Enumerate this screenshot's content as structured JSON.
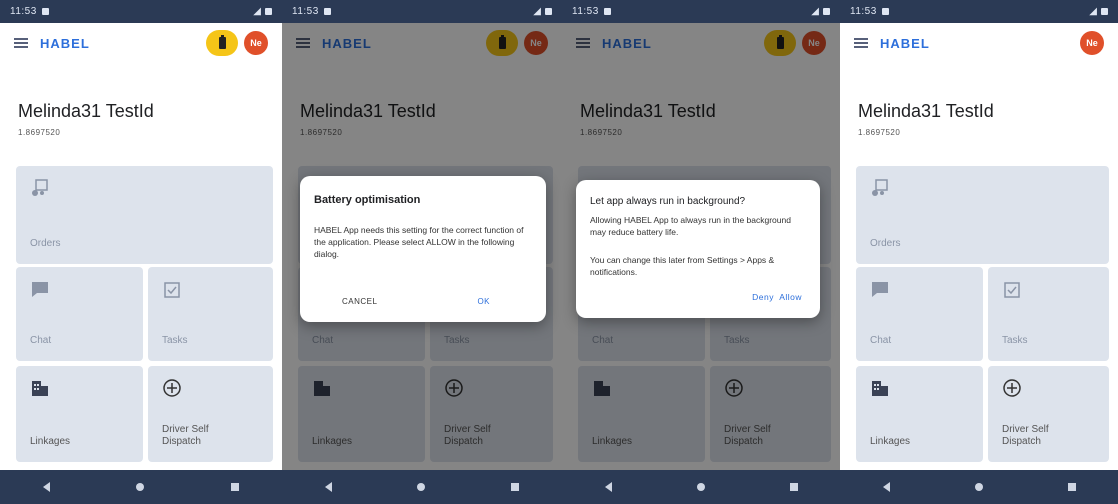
{
  "status_bar": {
    "left_text": "11:53",
    "right_text": ""
  },
  "app": {
    "brand": "HABEL",
    "avatar_initials": "Ne"
  },
  "profile": {
    "name": "Melinda31 TestId",
    "id_text": "1.8697520"
  },
  "tiles": {
    "orders": "Orders",
    "chat": "Chat",
    "tasks": "Tasks",
    "linkages": "Linkages",
    "driver_self_dispatch": "Driver Self Dispatch"
  },
  "dialog_battery": {
    "title": "Battery optimisation",
    "body": "HABEL App needs this setting for the correct function of the application. Please select ALLOW in the following dialog.",
    "cancel_label": "CANCEL",
    "ok_label": "OK"
  },
  "dialog_background": {
    "title": "Let app always run in background?",
    "body": "Allowing HABEL App to always run in the background may reduce battery life.",
    "body2": "You can change this later from Settings > Apps & notifications.",
    "deny_label": "Deny",
    "allow_label": "Allow"
  },
  "colors": {
    "brand": "#2d6fdb",
    "status_bar": "#2b3a55",
    "tile": "#dde3ec",
    "battery_pill": "#f5c518",
    "avatar": "#e0502a"
  }
}
